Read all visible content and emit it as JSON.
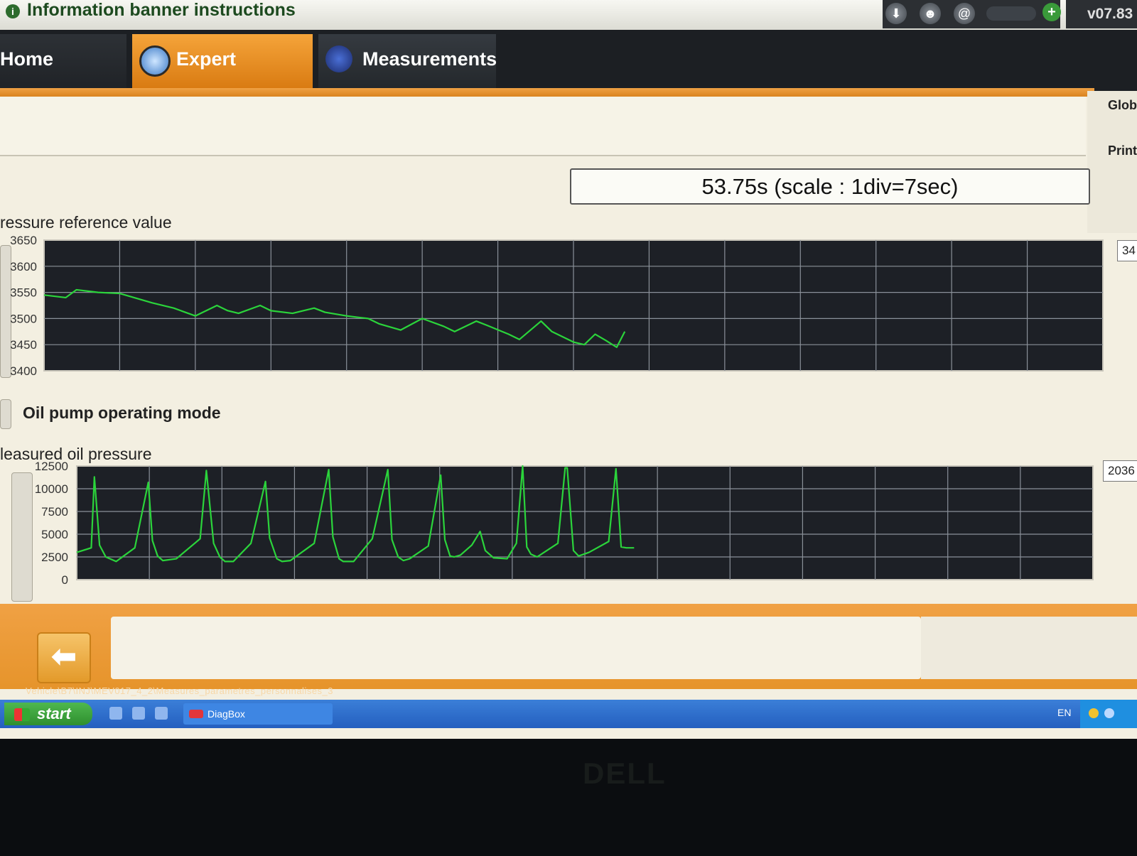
{
  "banner": {
    "title": "Information banner instructions",
    "version": "v07.83"
  },
  "tabs": [
    {
      "label": "Home"
    },
    {
      "label": "Expert"
    },
    {
      "label": "Measurements"
    }
  ],
  "right_rail": {
    "items": [
      "Glob",
      "Print"
    ]
  },
  "time_readout": "53.75s (scale : 1div=7sec)",
  "charts": {
    "pressure": {
      "title": "ressure reference value",
      "current_value": "34",
      "yticks": [
        "3650",
        "3600",
        "3550",
        "3500",
        "3450",
        "3400"
      ]
    },
    "oil_mode": {
      "title": "Oil pump operating mode"
    },
    "oil_pressure": {
      "title": "leasured oil pressure",
      "current_value": "2036",
      "yticks": [
        "12500",
        "10000",
        "7500",
        "5000",
        "2500",
        "0"
      ]
    }
  },
  "chart_data": [
    {
      "type": "line",
      "title": "ressure reference value",
      "ylim": [
        3400,
        3650
      ],
      "yticks": [
        3400,
        3450,
        3500,
        3550,
        3600,
        3650
      ],
      "x_unit": "s",
      "x_divisions": 14,
      "x_seconds_per_div": 7,
      "grid": true,
      "series": [
        {
          "color": "#2bd43b",
          "x": [
            0,
            2,
            3,
            5,
            7,
            10,
            12,
            14,
            16,
            17,
            18,
            20,
            21,
            23,
            25,
            26,
            28,
            30,
            31,
            33,
            35,
            37,
            38,
            40,
            41,
            43,
            44,
            46,
            47,
            49,
            50,
            51,
            52,
            53,
            53.75
          ],
          "y": [
            3545,
            3540,
            3555,
            3550,
            3548,
            3530,
            3520,
            3505,
            3525,
            3515,
            3510,
            3525,
            3515,
            3510,
            3520,
            3512,
            3505,
            3500,
            3490,
            3478,
            3500,
            3485,
            3475,
            3495,
            3487,
            3470,
            3460,
            3495,
            3475,
            3455,
            3450,
            3470,
            3458,
            3445,
            3475
          ]
        }
      ]
    },
    {
      "type": "line",
      "title": "leasured oil pressure",
      "ylim": [
        0,
        12500
      ],
      "yticks": [
        0,
        2500,
        5000,
        7500,
        10000,
        12500
      ],
      "x_unit": "s",
      "x_divisions": 14,
      "x_seconds_per_div": 7,
      "grid": true,
      "series": [
        {
          "color": "#2bd43b",
          "x": [
            0,
            1.4,
            1.7,
            2.2,
            2.8,
            3.8,
            5.6,
            6.9,
            7.3,
            7.8,
            8.3,
            9.6,
            11.9,
            12.5,
            13.2,
            13.8,
            14.3,
            15.1,
            16.8,
            18.2,
            18.6,
            19.3,
            19.8,
            20.6,
            22.9,
            24.3,
            24.7,
            25.3,
            25.7,
            26.7,
            28.5,
            30.0,
            30.4,
            31.0,
            31.5,
            32.1,
            33.9,
            35.1,
            35.5,
            36.0,
            36.4,
            37.0,
            38.1,
            38.9,
            39.4,
            40.2,
            41.5,
            42.4,
            43.0,
            43.4,
            43.8,
            44.4,
            46.4,
            47.1,
            47.3,
            47.9,
            48.4,
            49.4,
            51.3,
            52.0,
            52.5,
            53.0,
            53.3,
            53.75
          ],
          "y": [
            3000,
            3500,
            11300,
            3800,
            2500,
            2000,
            3500,
            10700,
            4300,
            2600,
            2100,
            2300,
            4500,
            12000,
            4000,
            2500,
            2000,
            2000,
            4000,
            10800,
            4600,
            2300,
            2000,
            2100,
            4000,
            12100,
            4700,
            2300,
            2000,
            2000,
            4500,
            12100,
            4400,
            2500,
            2100,
            2300,
            3700,
            11500,
            4400,
            2600,
            2500,
            2700,
            3800,
            5300,
            3200,
            2400,
            2300,
            4000,
            12500,
            3600,
            2800,
            2500,
            4000,
            12300,
            12300,
            3200,
            2600,
            3000,
            4200,
            12200,
            3600,
            3500,
            3500,
            3500
          ]
        }
      ]
    }
  ],
  "bottom": {
    "path": "Vehicle\\B7\\INJ\\MEV017_4_2\\Measures_parametres_personnalises_3"
  },
  "taskbar": {
    "start_label": "start",
    "app_label": "DiagBox",
    "language": "EN"
  },
  "bezel": {
    "logo": "DELL"
  }
}
